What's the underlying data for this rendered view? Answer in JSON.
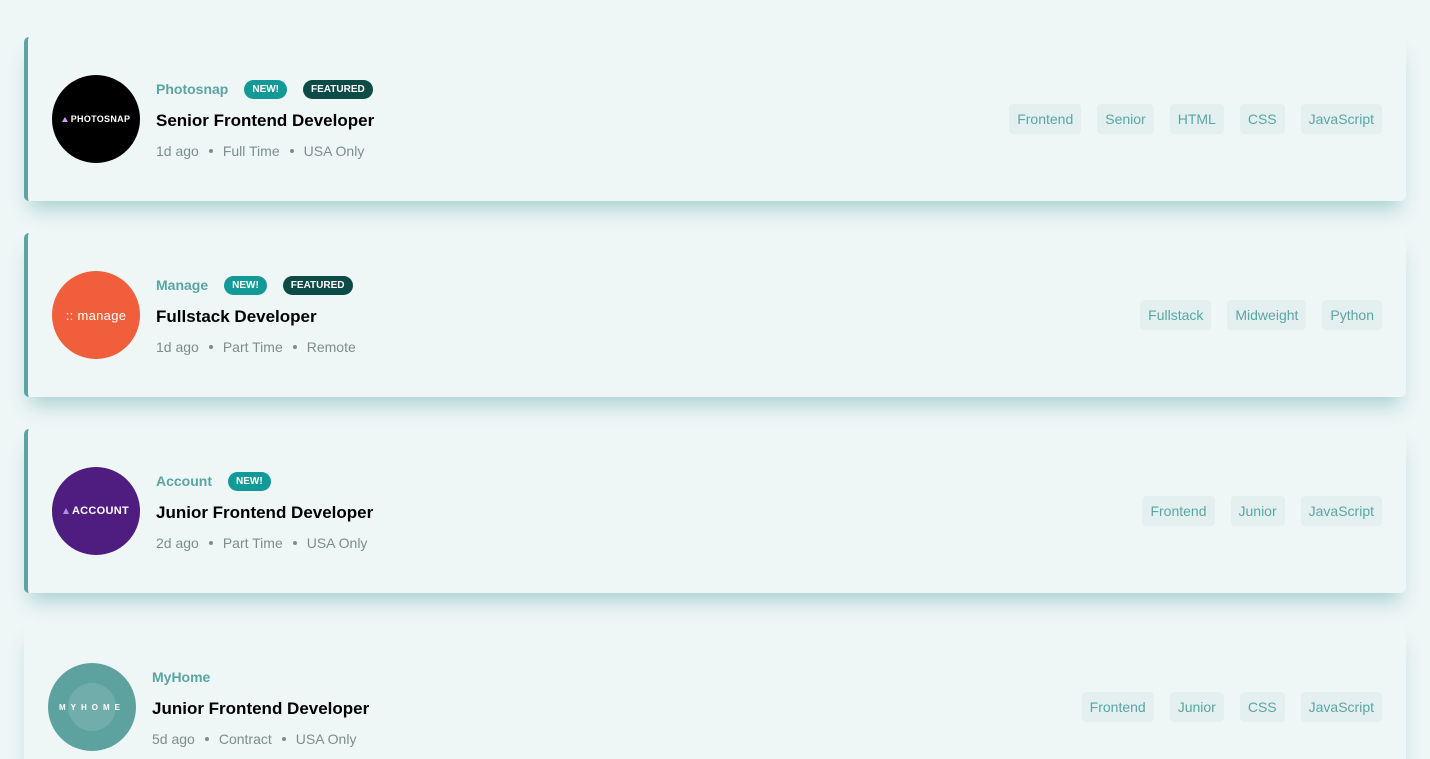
{
  "jobs": [
    {
      "company": "Photosnap",
      "logo_text": "PHOTOSNAP",
      "new_label": "NEW!",
      "featured_label": "FEATURED",
      "position": "Senior Frontend Developer",
      "posted_at": "1d ago",
      "contract": "Full Time",
      "location": "USA Only",
      "tags": [
        "Frontend",
        "Senior",
        "HTML",
        "CSS",
        "JavaScript"
      ],
      "logo_color": "#000000"
    },
    {
      "company": "Manage",
      "logo_text": ":: manage",
      "new_label": "NEW!",
      "featured_label": "FEATURED",
      "position": "Fullstack Developer",
      "posted_at": "1d ago",
      "contract": "Part Time",
      "location": "Remote",
      "tags": [
        "Fullstack",
        "Midweight",
        "Python"
      ],
      "logo_color": "#f15e3c"
    },
    {
      "company": "Account",
      "logo_text": "ACCOUNT",
      "new_label": "NEW!",
      "position": "Junior Frontend Developer",
      "posted_at": "2d ago",
      "contract": "Part Time",
      "location": "USA Only",
      "tags": [
        "Frontend",
        "Junior",
        "JavaScript"
      ],
      "logo_color": "#4f1c80"
    },
    {
      "company": "MyHome",
      "logo_text": "MYHOME",
      "position": "Junior Frontend Developer",
      "posted_at": "5d ago",
      "contract": "Contract",
      "location": "USA Only",
      "tags": [
        "Frontend",
        "Junior",
        "CSS",
        "JavaScript"
      ],
      "logo_color": "#5ea2a0"
    }
  ],
  "colors": {
    "accent": "#5ba4a4",
    "new_badge": "#139a98",
    "featured_badge": "#0d4b47",
    "background": "#eef6f6"
  }
}
